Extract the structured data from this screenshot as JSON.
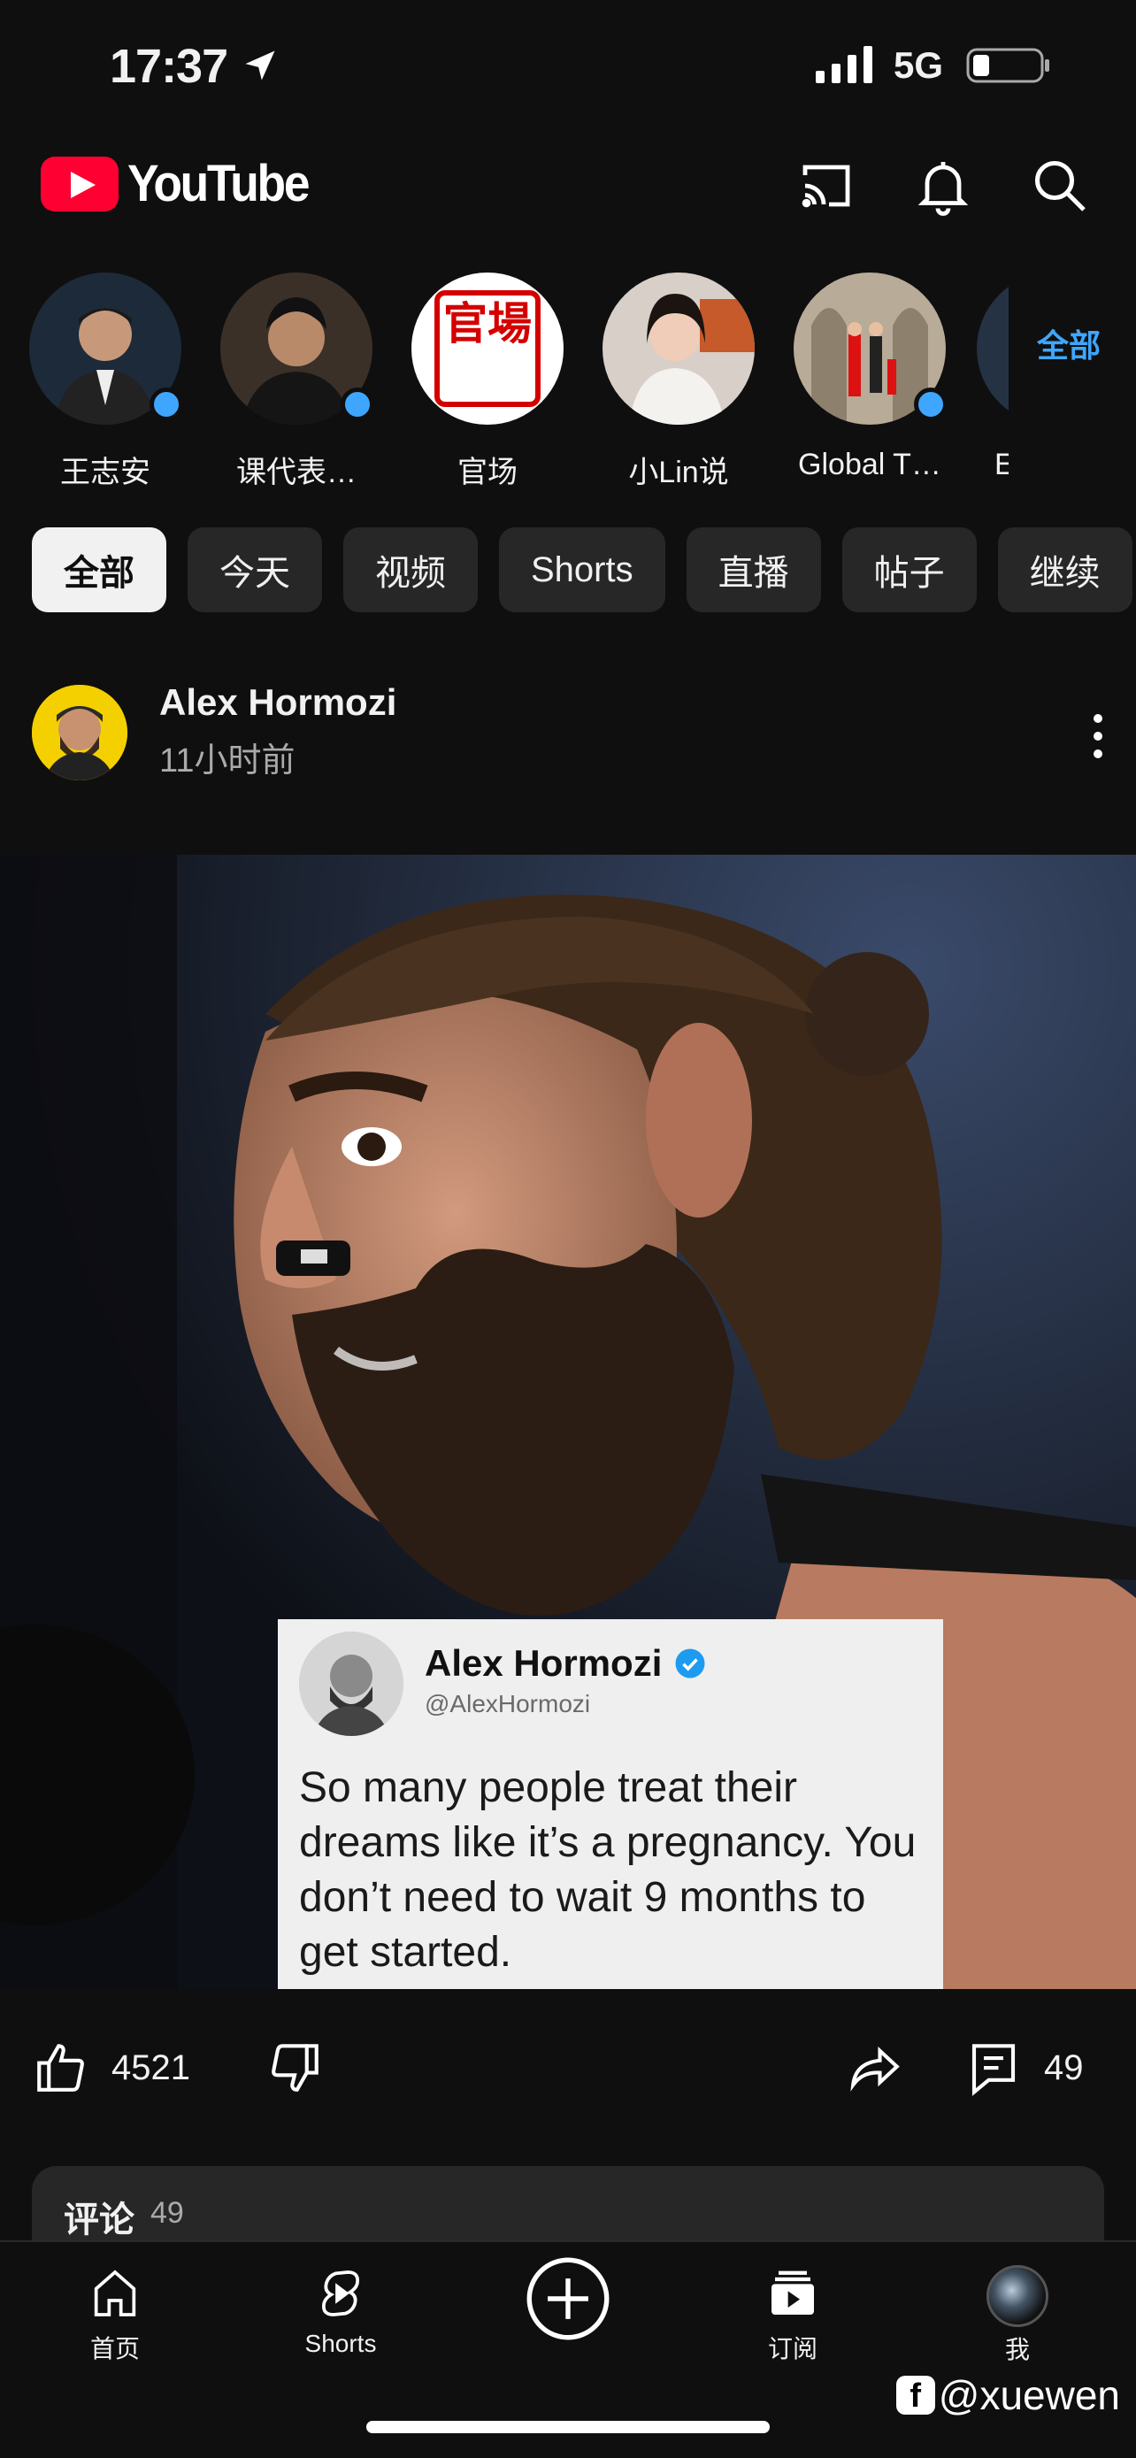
{
  "status_bar": {
    "time": "17:37",
    "network": "5G"
  },
  "header": {
    "logo_text": "YouTube"
  },
  "subscriptions": {
    "channels": [
      {
        "name": "王志安",
        "has_new": true
      },
      {
        "name": "课代表…",
        "has_new": true
      },
      {
        "name": "官场",
        "has_new": false
      },
      {
        "name": "小Lin说",
        "has_new": false
      },
      {
        "name": "Global T…",
        "has_new": true
      },
      {
        "name": "E",
        "has_new": false
      }
    ],
    "all_label": "全部",
    "logo_text": "官場"
  },
  "chips": [
    "全部",
    "今天",
    "视频",
    "Shorts",
    "直播",
    "帖子",
    "继续"
  ],
  "post": {
    "author": "Alex Hormozi",
    "time_ago": "11小时前",
    "tweet": {
      "name": "Alex Hormozi",
      "handle": "@AlexHormozi",
      "text": "So many people treat their dreams like it’s a pregnancy. You don’t need to wait 9 months to get started."
    },
    "likes": "4521",
    "comments_count": "49"
  },
  "comments_panel": {
    "title": "评论",
    "count": "49"
  },
  "bottom_nav": {
    "home": "首页",
    "shorts": "Shorts",
    "subscriptions": "订阅",
    "me": "我"
  },
  "watermark": "@xuewen",
  "colors": {
    "accent": "#3ea6ff",
    "brand": "#ff0033",
    "background": "#0f0f0f"
  }
}
